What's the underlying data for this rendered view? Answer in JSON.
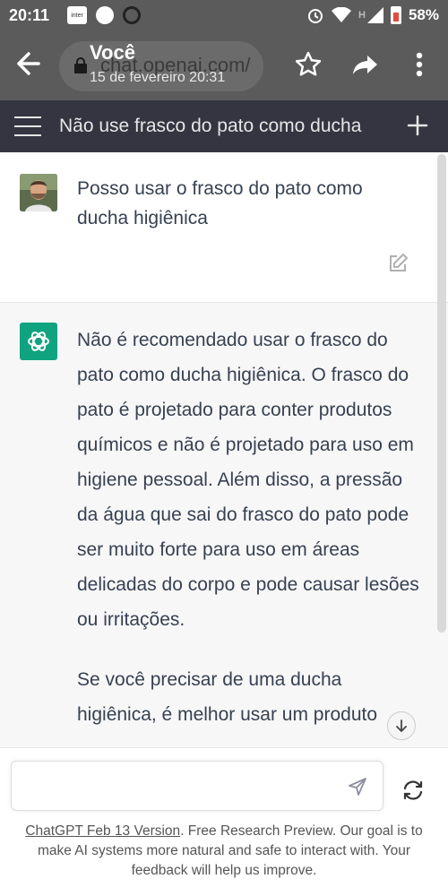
{
  "status_bar": {
    "time": "20:11",
    "inter_label": "inter",
    "network_label": "H",
    "battery_percent": "58%"
  },
  "browser": {
    "url": "chat.openai.com/",
    "tab_title": "Você",
    "tab_date": "15 de fevereiro 20:31"
  },
  "app_header": {
    "title": "Não use frasco do pato como ducha"
  },
  "messages": {
    "user": "Posso usar o frasco do pato como ducha higiênica",
    "assistant_p1": "Não é recomendado usar o frasco do pato como ducha higiênica. O frasco do pato é projetado para conter produtos químicos e não é projetado para uso em higiene pessoal. Além disso, a pressão da água que sai do frasco do pato pode ser muito forte para uso em áreas delicadas do corpo e pode causar lesões ou irritações.",
    "assistant_p2": "Se você precisar de uma ducha higiênica, é melhor usar um produto"
  },
  "composer": {
    "placeholder": ""
  },
  "footer": {
    "version_link": "ChatGPT Feb 13 Version",
    "text": ". Free Research Preview. Our goal is to make AI systems more natural and safe to interact with. Your feedback will help us improve."
  },
  "colors": {
    "chrome": "#5b5b5b",
    "app_header": "#343541",
    "assistant_bg": "#f7f7f8",
    "brand": "#10a37f"
  }
}
